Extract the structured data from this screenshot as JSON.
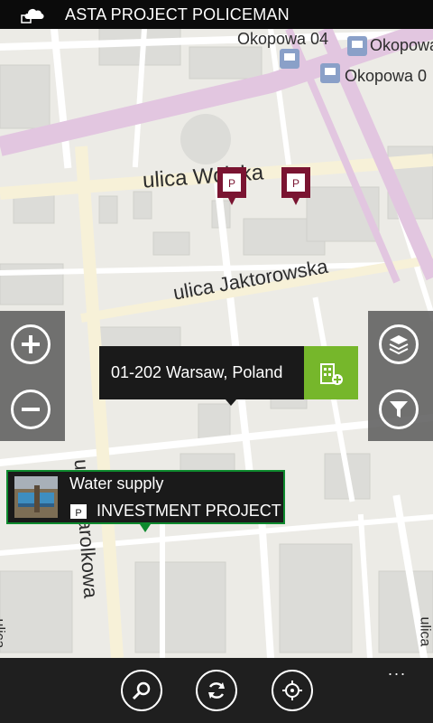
{
  "app": {
    "title": "ASTA PROJECT POLICEMAN",
    "logo_icon": "cloud-project-logo-icon"
  },
  "map": {
    "street_labels": {
      "wolska": "ulica Wolska",
      "jaktorowska": "ulica Jaktorowska",
      "karolkowa": "ulica Karolkowa",
      "okopowa_04": "Okopowa 04",
      "okopowa_a": "Okopowa",
      "okopowa_b": "Okopowa 0",
      "edge": "ulica",
      "edge_bottom_right": "ulica"
    },
    "colors": {
      "land": "#ecebe6",
      "road": "#ffffff",
      "main_road": "#f7f1d8",
      "tram": "#e2c6e0",
      "block": "#dcdcd8"
    }
  },
  "zoom_controls": {
    "zoom_in_icon": "zoom-in-icon",
    "zoom_out_icon": "zoom-out-icon"
  },
  "map_controls": {
    "layers_icon": "layers-icon",
    "filter_icon": "filter-icon"
  },
  "location_popup": {
    "address": "01-202 Warsaw, Poland",
    "add_icon": "add-building-icon",
    "accent": "#76b72b"
  },
  "project_callout": {
    "name": "Water supply",
    "type": "INVESTMENT PROJECT",
    "border": "#0e8a2e"
  },
  "pins": {
    "color": "#7a1431",
    "icon": "project-pin-icon"
  },
  "app_bar": {
    "search_icon": "search-icon",
    "refresh_icon": "refresh-icon",
    "locate_icon": "locate-icon",
    "more": "..."
  }
}
